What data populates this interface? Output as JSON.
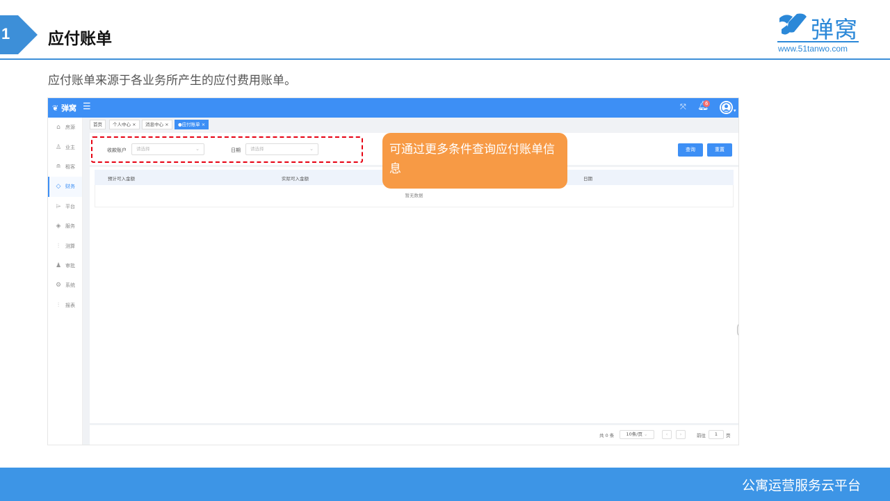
{
  "slide": {
    "number": "1",
    "title": "应付账单",
    "description": "应付账单来源于各业务所产生的应付费用账单。",
    "footer": "公寓运营服务云平台"
  },
  "brand": {
    "name": "弹窝",
    "url": "www.51tanwo.com",
    "color": "#2b88d8"
  },
  "app": {
    "topbar": {
      "logo": "弹窝",
      "notification_count": "6"
    },
    "sidebar": [
      {
        "label": "房源",
        "icon": "home-icon"
      },
      {
        "label": "业主",
        "icon": "user-icon"
      },
      {
        "label": "租客",
        "icon": "database-icon"
      },
      {
        "label": "财务",
        "icon": "diamond-icon",
        "active": true
      },
      {
        "label": "平台",
        "icon": "send-icon"
      },
      {
        "label": "服务",
        "icon": "tag-icon"
      },
      {
        "label": "测算",
        "icon": "sliders-icon"
      },
      {
        "label": "审批",
        "icon": "stamp-icon"
      },
      {
        "label": "系统",
        "icon": "gear-icon"
      },
      {
        "label": "报表",
        "icon": "chart-icon"
      }
    ],
    "tabs": [
      {
        "label": "首页"
      },
      {
        "label": "个人中心 ×"
      },
      {
        "label": "消息中心 ×"
      },
      {
        "label": "●应付账单 ×"
      }
    ],
    "filter": {
      "account_label": "收款账户",
      "account_placeholder": "请选择",
      "date_label": "日期",
      "date_placeholder": "请选择",
      "query_button": "查询",
      "reset_button": "重置"
    },
    "table": {
      "columns": [
        "预计可入金额",
        "实际可入金额",
        "日期"
      ],
      "empty_text": "暂无数据"
    },
    "pagination": {
      "total": "共 0 条",
      "page_size": "10条/页",
      "goto_label": "前往",
      "page": "1",
      "page_suffix": "页"
    }
  },
  "callout": {
    "text": "可通过更多条件查询应付账单信息"
  },
  "colors": {
    "primary": "#3d8ff5",
    "highlight": "#e60012",
    "callout": "#f79a45",
    "footer": "#3d95e6"
  }
}
